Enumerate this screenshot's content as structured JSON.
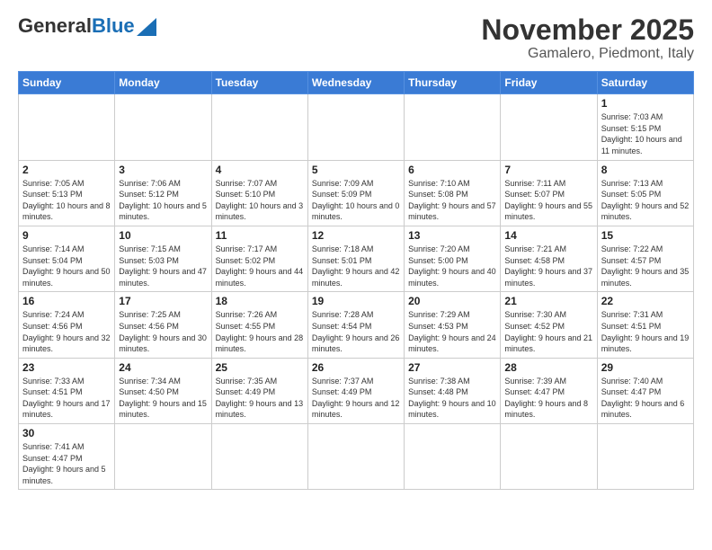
{
  "header": {
    "logo_general": "General",
    "logo_blue": "Blue",
    "title": "November 2025",
    "subtitle": "Gamalero, Piedmont, Italy"
  },
  "days_of_week": [
    "Sunday",
    "Monday",
    "Tuesday",
    "Wednesday",
    "Thursday",
    "Friday",
    "Saturday"
  ],
  "weeks": [
    {
      "days": [
        {
          "num": "",
          "info": ""
        },
        {
          "num": "",
          "info": ""
        },
        {
          "num": "",
          "info": ""
        },
        {
          "num": "",
          "info": ""
        },
        {
          "num": "",
          "info": ""
        },
        {
          "num": "",
          "info": ""
        },
        {
          "num": "1",
          "info": "Sunrise: 7:03 AM\nSunset: 5:15 PM\nDaylight: 10 hours\nand 11 minutes."
        }
      ]
    },
    {
      "days": [
        {
          "num": "2",
          "info": "Sunrise: 7:05 AM\nSunset: 5:13 PM\nDaylight: 10 hours\nand 8 minutes."
        },
        {
          "num": "3",
          "info": "Sunrise: 7:06 AM\nSunset: 5:12 PM\nDaylight: 10 hours\nand 5 minutes."
        },
        {
          "num": "4",
          "info": "Sunrise: 7:07 AM\nSunset: 5:10 PM\nDaylight: 10 hours\nand 3 minutes."
        },
        {
          "num": "5",
          "info": "Sunrise: 7:09 AM\nSunset: 5:09 PM\nDaylight: 10 hours\nand 0 minutes."
        },
        {
          "num": "6",
          "info": "Sunrise: 7:10 AM\nSunset: 5:08 PM\nDaylight: 9 hours\nand 57 minutes."
        },
        {
          "num": "7",
          "info": "Sunrise: 7:11 AM\nSunset: 5:07 PM\nDaylight: 9 hours\nand 55 minutes."
        },
        {
          "num": "8",
          "info": "Sunrise: 7:13 AM\nSunset: 5:05 PM\nDaylight: 9 hours\nand 52 minutes."
        }
      ]
    },
    {
      "days": [
        {
          "num": "9",
          "info": "Sunrise: 7:14 AM\nSunset: 5:04 PM\nDaylight: 9 hours\nand 50 minutes."
        },
        {
          "num": "10",
          "info": "Sunrise: 7:15 AM\nSunset: 5:03 PM\nDaylight: 9 hours\nand 47 minutes."
        },
        {
          "num": "11",
          "info": "Sunrise: 7:17 AM\nSunset: 5:02 PM\nDaylight: 9 hours\nand 44 minutes."
        },
        {
          "num": "12",
          "info": "Sunrise: 7:18 AM\nSunset: 5:01 PM\nDaylight: 9 hours\nand 42 minutes."
        },
        {
          "num": "13",
          "info": "Sunrise: 7:20 AM\nSunset: 5:00 PM\nDaylight: 9 hours\nand 40 minutes."
        },
        {
          "num": "14",
          "info": "Sunrise: 7:21 AM\nSunset: 4:58 PM\nDaylight: 9 hours\nand 37 minutes."
        },
        {
          "num": "15",
          "info": "Sunrise: 7:22 AM\nSunset: 4:57 PM\nDaylight: 9 hours\nand 35 minutes."
        }
      ]
    },
    {
      "days": [
        {
          "num": "16",
          "info": "Sunrise: 7:24 AM\nSunset: 4:56 PM\nDaylight: 9 hours\nand 32 minutes."
        },
        {
          "num": "17",
          "info": "Sunrise: 7:25 AM\nSunset: 4:56 PM\nDaylight: 9 hours\nand 30 minutes."
        },
        {
          "num": "18",
          "info": "Sunrise: 7:26 AM\nSunset: 4:55 PM\nDaylight: 9 hours\nand 28 minutes."
        },
        {
          "num": "19",
          "info": "Sunrise: 7:28 AM\nSunset: 4:54 PM\nDaylight: 9 hours\nand 26 minutes."
        },
        {
          "num": "20",
          "info": "Sunrise: 7:29 AM\nSunset: 4:53 PM\nDaylight: 9 hours\nand 24 minutes."
        },
        {
          "num": "21",
          "info": "Sunrise: 7:30 AM\nSunset: 4:52 PM\nDaylight: 9 hours\nand 21 minutes."
        },
        {
          "num": "22",
          "info": "Sunrise: 7:31 AM\nSunset: 4:51 PM\nDaylight: 9 hours\nand 19 minutes."
        }
      ]
    },
    {
      "days": [
        {
          "num": "23",
          "info": "Sunrise: 7:33 AM\nSunset: 4:51 PM\nDaylight: 9 hours\nand 17 minutes."
        },
        {
          "num": "24",
          "info": "Sunrise: 7:34 AM\nSunset: 4:50 PM\nDaylight: 9 hours\nand 15 minutes."
        },
        {
          "num": "25",
          "info": "Sunrise: 7:35 AM\nSunset: 4:49 PM\nDaylight: 9 hours\nand 13 minutes."
        },
        {
          "num": "26",
          "info": "Sunrise: 7:37 AM\nSunset: 4:49 PM\nDaylight: 9 hours\nand 12 minutes."
        },
        {
          "num": "27",
          "info": "Sunrise: 7:38 AM\nSunset: 4:48 PM\nDaylight: 9 hours\nand 10 minutes."
        },
        {
          "num": "28",
          "info": "Sunrise: 7:39 AM\nSunset: 4:47 PM\nDaylight: 9 hours\nand 8 minutes."
        },
        {
          "num": "29",
          "info": "Sunrise: 7:40 AM\nSunset: 4:47 PM\nDaylight: 9 hours\nand 6 minutes."
        }
      ]
    },
    {
      "days": [
        {
          "num": "30",
          "info": "Sunrise: 7:41 AM\nSunset: 4:47 PM\nDaylight: 9 hours\nand 5 minutes."
        },
        {
          "num": "",
          "info": ""
        },
        {
          "num": "",
          "info": ""
        },
        {
          "num": "",
          "info": ""
        },
        {
          "num": "",
          "info": ""
        },
        {
          "num": "",
          "info": ""
        },
        {
          "num": "",
          "info": ""
        }
      ]
    }
  ]
}
